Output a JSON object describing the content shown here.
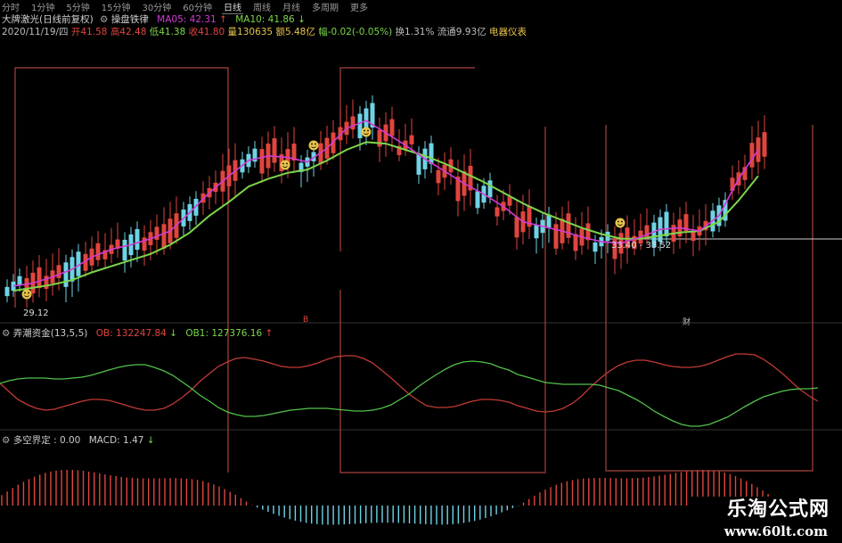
{
  "tabs": [
    "分时",
    "1分钟",
    "5分钟",
    "15分钟",
    "30分钟",
    "60分钟",
    "日线",
    "周线",
    "月线",
    "多周期",
    "更多"
  ],
  "header": {
    "indicator": "大牌激光(日线前复权)",
    "tool": "操盘铁律",
    "ma05": "MA05: 42.31",
    "ma10": "MA10: 41.86",
    "date": "2020/11/19/四",
    "open": "开41.58",
    "high": "高42.48",
    "low": "低41.38",
    "close": "收41.80",
    "volume": "量130635",
    "amount": "额5.48亿",
    "change": "幅-0.02(-0.05%)",
    "turnover": "换1.31%",
    "float_cap": "流通9.93亿",
    "sector": "电器仪表"
  },
  "price_labels": {
    "low_mark": "29.12",
    "range_mark": "33.40 - 33.52",
    "marker_b": "B",
    "marker_cai": "财"
  },
  "panel2": {
    "name": "弄潮资金(13,5,5)",
    "ob": "OB: 132247.84",
    "ob1": "OB1: 127376.16"
  },
  "panel3": {
    "name": "多空界定 : 0.00",
    "macd": "MACD: 1.47"
  },
  "watermark": {
    "title": "乐淘公式网",
    "url": "www.60lt.com"
  },
  "colors": {
    "up": "#e0453e",
    "down": "#6fd3e6",
    "ma5": "#d23ad6",
    "ma10": "#7cd64a",
    "ob": "#c23a34",
    "ob1": "#52c24a",
    "frame": "#a8423c"
  },
  "chart_data": {
    "type": "candlestick",
    "ma05": [
      30.4,
      30.6,
      31.0,
      31.5,
      32.3,
      32.8,
      33.1,
      33.5,
      34.0,
      35.2,
      36.5,
      37.6,
      38.6,
      38.9,
      38.8,
      38.5,
      39.4,
      40.7,
      41.2,
      40.4,
      39.6,
      38.7,
      37.9,
      37.1,
      36.4,
      35.6,
      34.6,
      34.3,
      34.0,
      33.6,
      33.3,
      33.2,
      33.6,
      34.1,
      34.2,
      34.0,
      35.0,
      37.4,
      39.3
    ],
    "ma10": [
      30.1,
      30.3,
      30.5,
      30.8,
      31.3,
      31.7,
      32.1,
      32.5,
      33.1,
      33.9,
      35.0,
      35.9,
      36.9,
      37.4,
      37.8,
      38.0,
      38.6,
      39.3,
      39.8,
      39.7,
      39.3,
      38.9,
      38.4,
      37.8,
      37.2,
      36.5,
      35.8,
      35.2,
      34.7,
      34.2,
      33.8,
      33.5,
      33.5,
      33.7,
      33.9,
      34.0,
      34.6,
      36.0,
      37.6
    ]
  }
}
